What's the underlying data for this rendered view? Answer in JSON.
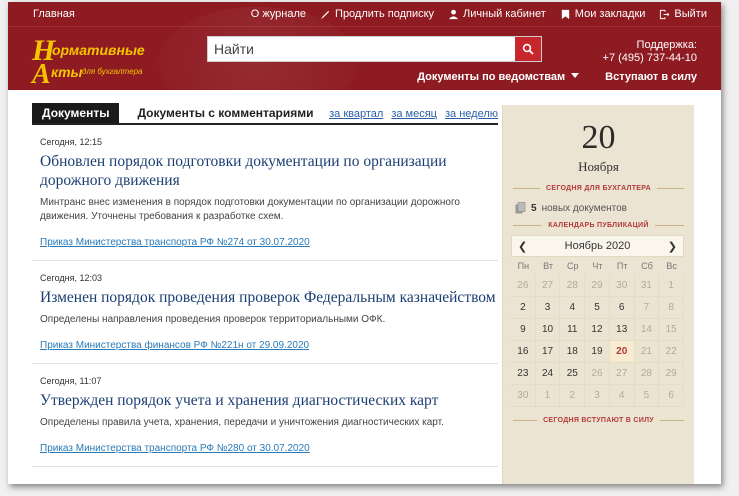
{
  "topbar": {
    "home": "Главная",
    "links": [
      {
        "label": "О журнале",
        "icon": "none"
      },
      {
        "label": "Продлить подписку",
        "icon": "pencil-icon"
      },
      {
        "label": "Личный кабинет",
        "icon": "user-icon"
      },
      {
        "label": "Мои закладки",
        "icon": "bookmark-icon"
      },
      {
        "label": "Выйти",
        "icon": "logout-icon"
      }
    ]
  },
  "header": {
    "logo_line1": "ормативные",
    "logo_line2": "кты",
    "logo_sub": "для бухгалтера",
    "search_placeholder": "Найти",
    "support_label": "Поддержка:",
    "support_phone": "+7 (495) 737-44-10",
    "nav_departments": "Документы по ведомствам",
    "nav_in_force": "Вступают в силу"
  },
  "tabs": {
    "active": "Документы",
    "other": "Документы с комментариями",
    "periods": [
      "за квартал",
      "за месяц",
      "за неделю"
    ]
  },
  "news": [
    {
      "time": "Сегодня, 12:15",
      "title": "Обновлен порядок подготовки документации по организации дорожного движения",
      "text": "Минтранс внес изменения в порядок подготовки документации по организации дорожного движения. Уточнены требования к разработке схем.",
      "link": "Приказ Министерства транспорта РФ №274 от 30.07.2020"
    },
    {
      "time": "Сегодня, 12:03",
      "title": "Изменен порядок проведения проверок Федеральным казначейством",
      "text": "Определены направления проведения проверок территориальными ОФК.",
      "link": "Приказ Министерства финансов РФ №221н от 29.09.2020"
    },
    {
      "time": "Сегодня, 11:07",
      "title": "Утвержден порядок учета и хранения диагностических карт",
      "text": "Определены правила учета, хранения, передачи и уничтожения диагностических карт.",
      "link": "Приказ Министерства транспорта РФ №280 от 30.07.2020"
    }
  ],
  "sidebar": {
    "day": "20",
    "month": "Ноября",
    "today_caption": "СЕГОДНЯ ДЛЯ БУХГАЛТЕРА",
    "new_docs_count": "5",
    "new_docs_text": "новых документов",
    "calendar_caption": "КАЛЕНДАРЬ ПУБЛИКАЦИЙ",
    "calendar_month": "Ноябрь 2020",
    "weekdays": [
      "Пн",
      "Вт",
      "Ср",
      "Чт",
      "Пт",
      "Сб",
      "Вс"
    ],
    "weeks": [
      [
        "26",
        "27",
        "28",
        "29",
        "30",
        "31",
        "1"
      ],
      [
        "2",
        "3",
        "4",
        "5",
        "6",
        "7",
        "8"
      ],
      [
        "9",
        "10",
        "11",
        "12",
        "13",
        "14",
        "15"
      ],
      [
        "16",
        "17",
        "18",
        "19",
        "20",
        "21",
        "22"
      ],
      [
        "23",
        "24",
        "25",
        "26",
        "27",
        "28",
        "29"
      ],
      [
        "30",
        "1",
        "2",
        "3",
        "4",
        "5",
        "6"
      ]
    ],
    "inactive": [
      [
        true,
        true,
        true,
        true,
        true,
        true,
        true
      ],
      [
        false,
        false,
        false,
        false,
        false,
        true,
        true
      ],
      [
        false,
        false,
        false,
        false,
        false,
        true,
        true
      ],
      [
        false,
        false,
        false,
        false,
        false,
        true,
        true
      ],
      [
        false,
        false,
        false,
        true,
        true,
        true,
        true
      ],
      [
        true,
        true,
        true,
        true,
        true,
        true,
        true
      ]
    ],
    "today_index": [
      3,
      4
    ],
    "in_force_caption": "СЕГОДНЯ ВСТУПАЮТ В СИЛУ"
  },
  "colors": {
    "brand": "#8e1b22",
    "accent": "#c8262d",
    "logo": "#f5c400"
  }
}
